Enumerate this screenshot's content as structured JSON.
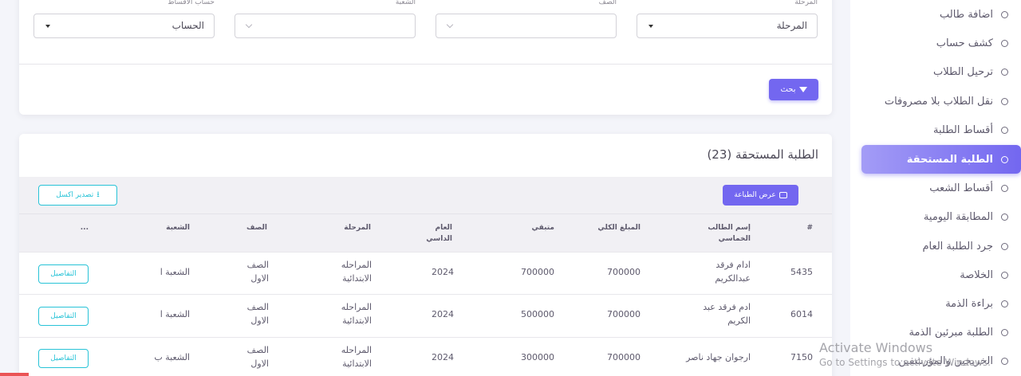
{
  "sidebar": {
    "items": [
      {
        "label": "اضافة طالب",
        "active": false
      },
      {
        "label": "كشف حساب",
        "active": false
      },
      {
        "label": "ترحيل الطلاب",
        "active": false
      },
      {
        "label": "نقل الطلاب بلا مصروفات",
        "active": false
      },
      {
        "label": "أقساط الطلبة",
        "active": false
      },
      {
        "label": "الطلبة المستحقة",
        "active": true
      },
      {
        "label": "أقساط الشعب",
        "active": false
      },
      {
        "label": "المطابقة اليومية",
        "active": false
      },
      {
        "label": "جرد الطلبة العام",
        "active": false
      },
      {
        "label": "الخلاصة",
        "active": false
      },
      {
        "label": "براءة الذمة",
        "active": false
      },
      {
        "label": "الطلبة مبرئين الذمة",
        "active": false
      },
      {
        "label": "الخريجين والمؤرشفين",
        "active": false
      }
    ]
  },
  "filters": {
    "stage": {
      "label": "المرحلة",
      "value": "المرحلة"
    },
    "grade": {
      "label": "الصف",
      "value": ""
    },
    "section": {
      "label": "الشعبة",
      "value": ""
    },
    "installments_account": {
      "label": "حساب الاقساط",
      "value": "الحساب"
    },
    "search_button": "بحث"
  },
  "results": {
    "title": "الطلبة المستحقة (23)",
    "print_button": "عرض الطباعة",
    "export_button": "تصدير اكسل",
    "columns": {
      "id": "#",
      "name": "إسم الطالب الخماسي",
      "total": "المبلغ الكلي",
      "remaining": "متبقي",
      "year": "العام الداسي",
      "stage": "المرحلة",
      "grade": "الصف",
      "section": "الشعبة",
      "actions": "..."
    },
    "rows": [
      {
        "id": "5435",
        "name": "ادام فرقد عبدالكريم",
        "total": "700000",
        "remaining": "700000",
        "year": "2024",
        "stage": "المراحله الابتدائية",
        "grade": "الصف الاول",
        "section": "الشعبة ا",
        "details": "التفاصيل"
      },
      {
        "id": "6014",
        "name": "ادم فرقد عبد الكريم",
        "total": "700000",
        "remaining": "500000",
        "year": "2024",
        "stage": "المراحله الابتدائية",
        "grade": "الصف الاول",
        "section": "الشعبة ا",
        "details": "التفاصيل"
      },
      {
        "id": "7150",
        "name": "ارجوان جهاد ناصر",
        "total": "700000",
        "remaining": "300000",
        "year": "2024",
        "stage": "المراحله الابتدائية",
        "grade": "الصف الاول",
        "section": "الشعبة ب",
        "details": "التفاصيل"
      }
    ]
  },
  "watermark": {
    "line1": "Activate Windows",
    "line2": "Go to Settings to activate Windows."
  },
  "colors": {
    "accent": "#7367f0",
    "info": "#28c3d7",
    "background": "#f4f5fa"
  }
}
